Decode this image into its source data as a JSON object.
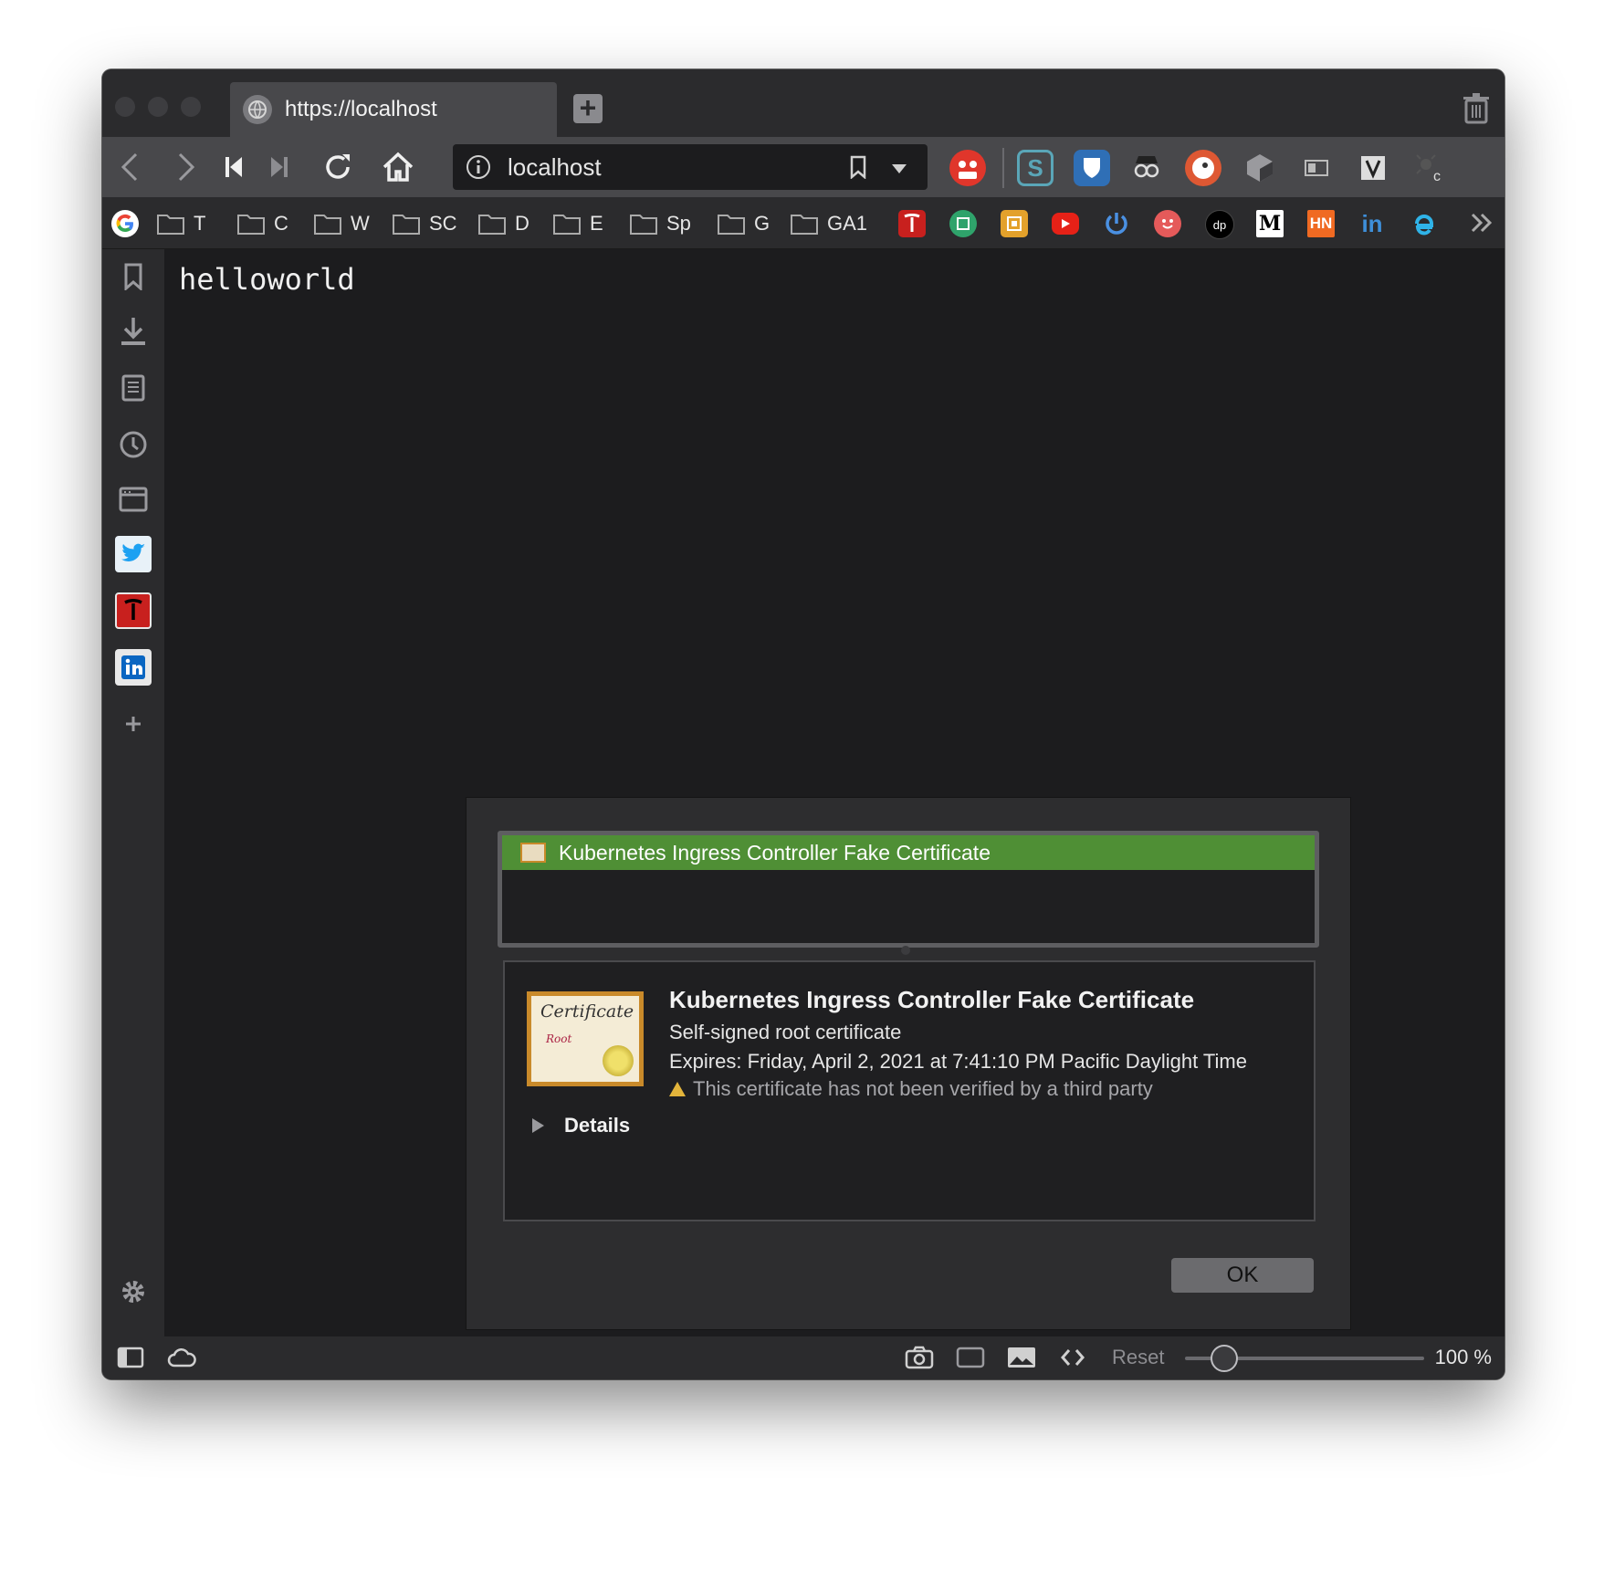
{
  "tab": {
    "title": "https://localhost",
    "favicon": "globe-icon"
  },
  "urlbar": {
    "url": "localhost"
  },
  "bookmarks": {
    "folders": [
      "T",
      "C",
      "W",
      "SC",
      "D",
      "E",
      "Sp",
      "G",
      "GA1"
    ],
    "icons": [
      "google-icon",
      "tesla-icon",
      "green-icon",
      "yellow-icon",
      "youtube-icon",
      "power-icon",
      "face-icon",
      "dp-icon",
      "medium-icon",
      "hn-icon",
      "linkedin-icon",
      "edge-icon"
    ],
    "medium_letter": "M",
    "hn_letters": "HN",
    "linkedin_letters": "in",
    "dp_letters": "dp"
  },
  "page": {
    "text": "helloworld"
  },
  "dialog": {
    "list_item": "Kubernetes Ingress Controller Fake Certificate",
    "cert_image_title": "Certificate",
    "cert_image_subtitle": "Root",
    "title": "Kubernetes Ingress Controller Fake Certificate",
    "type": "Self-signed root certificate",
    "expires": "Expires: Friday, April 2, 2021 at 7:41:10 PM Pacific Daylight Time",
    "warning": "This certificate has not been verified by a third party",
    "details_label": "Details",
    "ok_label": "OK"
  },
  "statusbar": {
    "reset_label": "Reset",
    "zoom": "100 %",
    "zoom_value": 100
  },
  "colors": {
    "accent_green": "#4f8f35",
    "chrome": "#2b2b2d",
    "bg": "#1c1c1e"
  }
}
